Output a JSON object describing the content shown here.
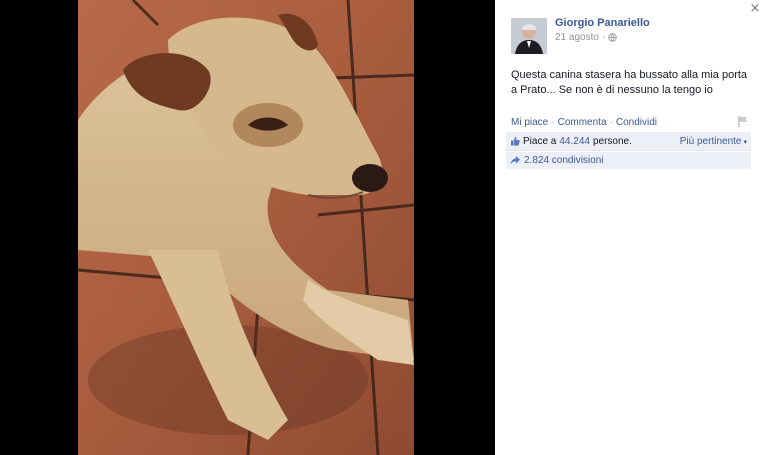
{
  "viewer": {
    "close_label": "×"
  },
  "post": {
    "author": "Giorgio Panariello",
    "date": "21 agosto",
    "privacy_icon": "globe-icon",
    "text": "Questa canina stasera ha bussato alla mia porta a Prato... Se non è di nessuno la tengo io"
  },
  "actions": {
    "like": "Mi piace",
    "comment": "Commenta",
    "share": "Condividi",
    "separator": "·"
  },
  "likes": {
    "prefix": "Piace a",
    "count": "44.244",
    "suffix": "persone.",
    "sort_label": "Più pertinente",
    "sort_caret": "▾"
  },
  "shares": {
    "label": "2.824 condivisioni"
  },
  "colors": {
    "link": "#3b5998",
    "panel_bg": "#ffffff",
    "likes_bg": "#eceff5",
    "viewer_bg": "#000000"
  }
}
